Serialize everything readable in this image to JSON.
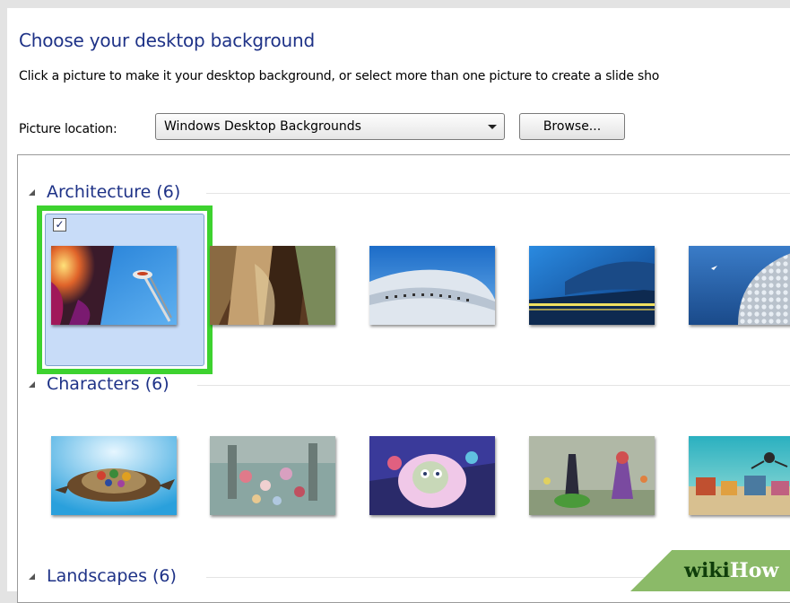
{
  "dialog": {
    "title": "Choose your desktop background",
    "instructions": "Click a picture to make it your desktop background, or select more than one picture to create a slide sho"
  },
  "location": {
    "label": "Picture location:",
    "selected": "Windows Desktop Backgrounds",
    "browse_label": "Browse..."
  },
  "groups": [
    {
      "label": "Architecture (6)",
      "pictures": [
        {
          "name": "architecture-1",
          "selected": true
        },
        {
          "name": "architecture-2",
          "selected": false
        },
        {
          "name": "architecture-3",
          "selected": false
        },
        {
          "name": "architecture-4",
          "selected": false
        },
        {
          "name": "architecture-5",
          "selected": false
        }
      ]
    },
    {
      "label": "Characters (6)",
      "pictures": [
        {
          "name": "characters-1",
          "selected": false
        },
        {
          "name": "characters-2",
          "selected": false
        },
        {
          "name": "characters-3",
          "selected": false
        },
        {
          "name": "characters-4",
          "selected": false
        },
        {
          "name": "characters-5",
          "selected": false
        }
      ]
    },
    {
      "label": "Landscapes (6)",
      "pictures": []
    }
  ],
  "checkbox_glyph": "✓",
  "watermark": {
    "part1": "wiki",
    "part2": "How"
  },
  "colors": {
    "heading": "#1e3287",
    "selection_highlight": "#3dd22f",
    "selection_fill": "#c8dcf8",
    "watermark_bg": "#8bba68"
  }
}
